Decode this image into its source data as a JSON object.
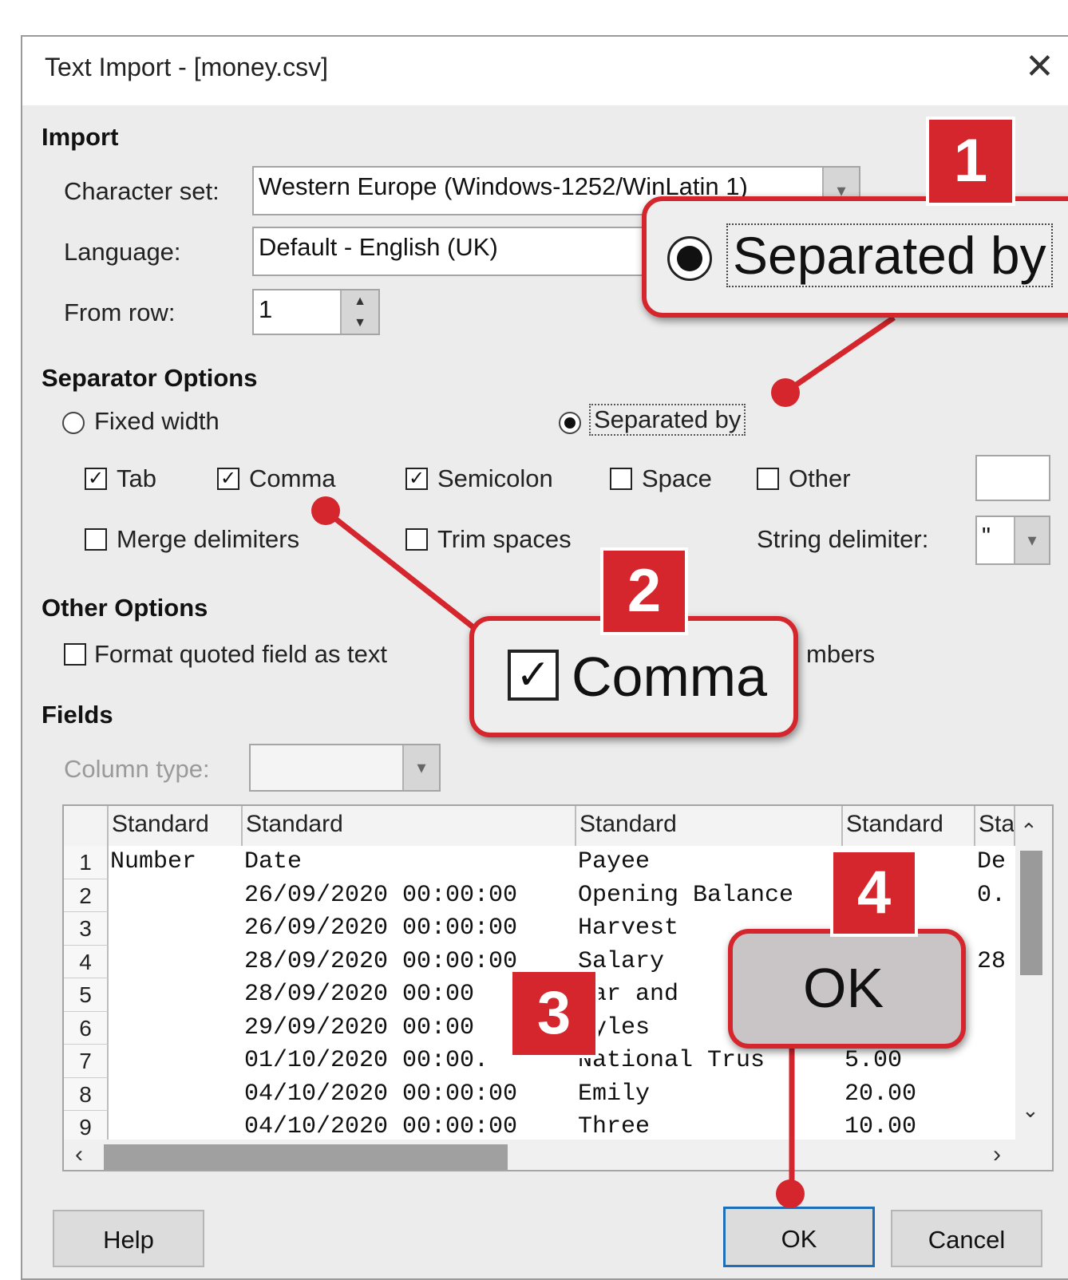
{
  "dialog": {
    "title": "Text Import - [money.csv]",
    "close": "✕"
  },
  "import": {
    "heading": "Import",
    "charset_label": "Character set:",
    "charset_value": "Western Europe (Windows-1252/WinLatin 1)",
    "language_label": "Language:",
    "language_value": "Default - English (UK)",
    "fromrow_label": "From row:",
    "fromrow_value": "1"
  },
  "separator": {
    "heading": "Separator Options",
    "fixed_width": "Fixed width",
    "separated_by": "Separated by",
    "tab": "Tab",
    "comma": "Comma",
    "semicolon": "Semicolon",
    "space": "Space",
    "other": "Other",
    "merge": "Merge delimiters",
    "trim": "Trim spaces",
    "string_delim_label": "String delimiter:",
    "string_delim_value": "\""
  },
  "other_options": {
    "heading": "Other Options",
    "format_quoted": "Format quoted field as text",
    "detect_numbers_partial": "mbers"
  },
  "fields": {
    "heading": "Fields",
    "column_type_label": "Column type:",
    "headers": [
      "Standard",
      "Standard",
      "Standard",
      "Standard",
      "Sta"
    ],
    "rows": [
      {
        "n": "1",
        "c1": "Number",
        "c2": "Date",
        "c3": "Payee",
        "c4": "nt",
        "c5": "De"
      },
      {
        "n": "2",
        "c1": "",
        "c2": "26/09/2020 00:00:00",
        "c3": "Opening Balance",
        "c4": "",
        "c5": "0."
      },
      {
        "n": "3",
        "c1": "",
        "c2": "26/09/2020 00:00:00",
        "c3": "Harvest",
        "c4": "",
        "c5": ""
      },
      {
        "n": "4",
        "c1": "",
        "c2": "28/09/2020 00:00:00",
        "c3": "Salary",
        "c4": "",
        "c5": "28"
      },
      {
        "n": "5",
        "c1": "",
        "c2": "28/09/2020 00:00",
        "c3": "tar and",
        "c4": "",
        "c5": ""
      },
      {
        "n": "6",
        "c1": "",
        "c2": "29/09/2020 00:00",
        "c3": "oyles",
        "c4": "",
        "c5": ""
      },
      {
        "n": "7",
        "c1": "",
        "c2": "01/10/2020 00:00.",
        "c3": "National Trus",
        "c4": "5.00",
        "c5": ""
      },
      {
        "n": "8",
        "c1": "",
        "c2": "04/10/2020 00:00:00",
        "c3": "Emily",
        "c4": "20.00",
        "c5": ""
      },
      {
        "n": "9",
        "c1": "",
        "c2": "04/10/2020 00:00:00",
        "c3": "Three",
        "c4": "10.00",
        "c5": ""
      }
    ]
  },
  "buttons": {
    "help": "Help",
    "ok": "OK",
    "cancel": "Cancel"
  },
  "callouts": {
    "badge1": "1",
    "badge2": "2",
    "badge3": "3",
    "badge4": "4",
    "zoom_separated": "Separated by",
    "zoom_comma": "Comma",
    "zoom_ok": "OK"
  },
  "colors": {
    "callout_red": "#d4262c",
    "dialog_bg": "#ececec"
  }
}
